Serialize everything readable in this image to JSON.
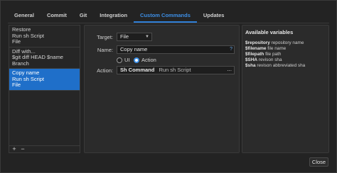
{
  "tabs": [
    "General",
    "Commit",
    "Git",
    "Integration",
    "Custom Commands",
    "Updates"
  ],
  "active_tab": "Custom Commands",
  "commands": [
    {
      "lines": [
        "Restore",
        "Run sh Script",
        "File"
      ],
      "selected": false
    },
    {
      "lines": [
        "Diff with...",
        "$git diff HEAD $name",
        "Branch"
      ],
      "selected": false
    },
    {
      "lines": [
        "Copy name",
        "Run sh Script",
        "File"
      ],
      "selected": true
    }
  ],
  "list_footer": {
    "add": "+",
    "remove": "−"
  },
  "form": {
    "target_label": "Target:",
    "target_value": "File",
    "name_label": "Name:",
    "name_value": "Copy name",
    "help_glyph": "?",
    "radio_ui": "UI",
    "radio_action": "Action",
    "radio_selected": "Action",
    "action_label": "Action:",
    "action_type": "Sh Command",
    "action_detail": "Run sh Script",
    "more_glyph": "..."
  },
  "variables": {
    "title": "Available variables",
    "items": [
      {
        "name": "$repository",
        "desc": "repository name"
      },
      {
        "name": "$filename",
        "desc": "file name"
      },
      {
        "name": "$filepath",
        "desc": "file path"
      },
      {
        "name": "$SHA",
        "desc": "revison sha"
      },
      {
        "name": "$sha",
        "desc": "revison abbreviated sha"
      }
    ]
  },
  "close_label": "Close",
  "colors": {
    "accent": "#2f7fd6",
    "selection": "#1f6fc9",
    "background": "#232323"
  }
}
